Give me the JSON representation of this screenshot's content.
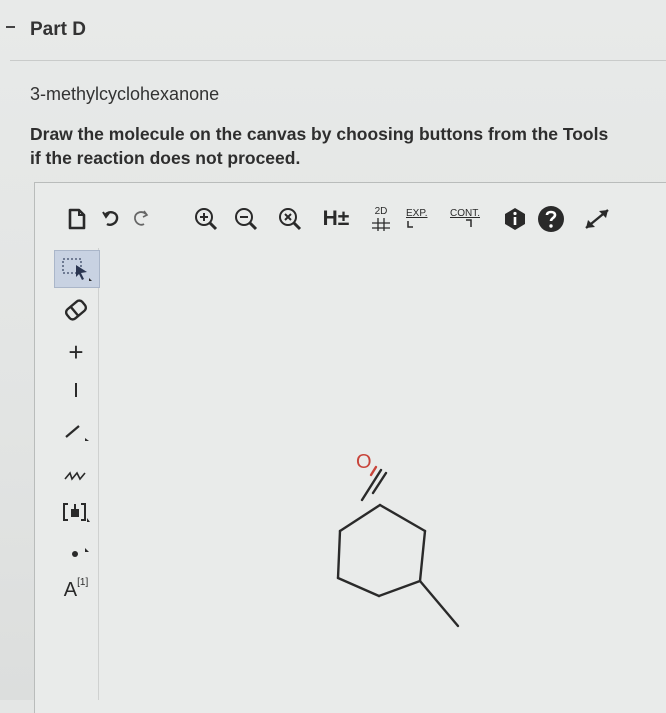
{
  "part": {
    "title": "Part D"
  },
  "question": {
    "molecule": "3-methylcyclohexanone",
    "instructions_line1": "Draw the molecule on the canvas by choosing buttons from the Tools",
    "instructions_line2": "if the reaction does not proceed."
  },
  "toolbar": {
    "h_toggle": "H±",
    "label_2d": "2D",
    "label_exp": "EXP.",
    "label_cont": "CONT."
  },
  "sidebar": {
    "add_label": "+",
    "remove_label": "–",
    "atom_label": "A",
    "atom_index": "[1]"
  },
  "canvas": {
    "oxygen_label": "O"
  },
  "colors": {
    "oxygen": "#c8443a",
    "active_tool": "#c8d2e2",
    "bond": "#2a2a2a"
  }
}
